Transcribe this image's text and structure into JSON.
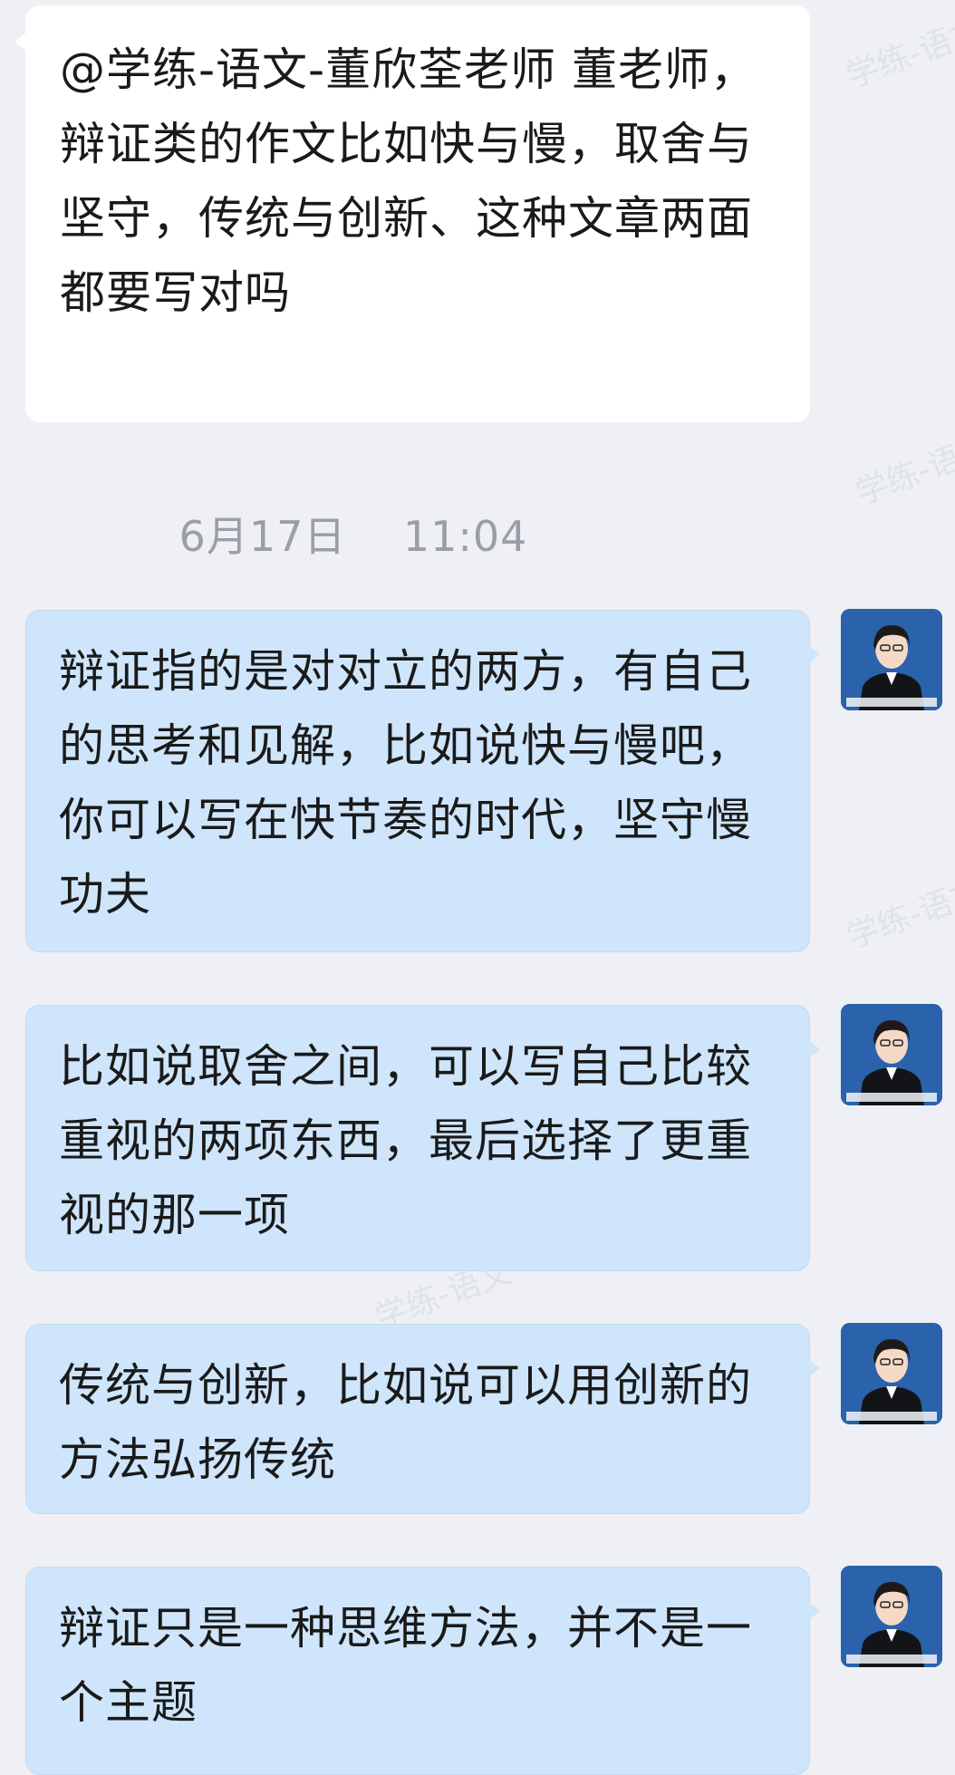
{
  "incoming": {
    "text": "@学练-语文-董欣荃老师 董老师，辩证类的作文比如快与慢，取舍与坚守，传统与创新、这种文章两面都要写对吗"
  },
  "timestamp": {
    "date": "6月17日",
    "time": "11:04"
  },
  "replies": [
    {
      "text": "辩证指的是对对立的两方，有自己的思考和见解，比如说快与慢吧，你可以写在快节奏的时代，坚守慢功夫"
    },
    {
      "text": "比如说取舍之间，可以写自己比较重视的两项东西，最后选择了更重视的那一项"
    },
    {
      "text": "传统与创新，比如说可以用创新的方法弘扬传统"
    },
    {
      "text": "辩证只是一种思维方法，并不是一个主题"
    }
  ],
  "avatar": {
    "icon": "teacher-avatar-icon"
  },
  "watermark": {
    "text": "学练-语文"
  },
  "colors": {
    "background": "#eef0f5",
    "incoming_bubble": "#ffffff",
    "outgoing_bubble": "#cfe5fb",
    "timestamp_text": "#9b9ea6"
  }
}
